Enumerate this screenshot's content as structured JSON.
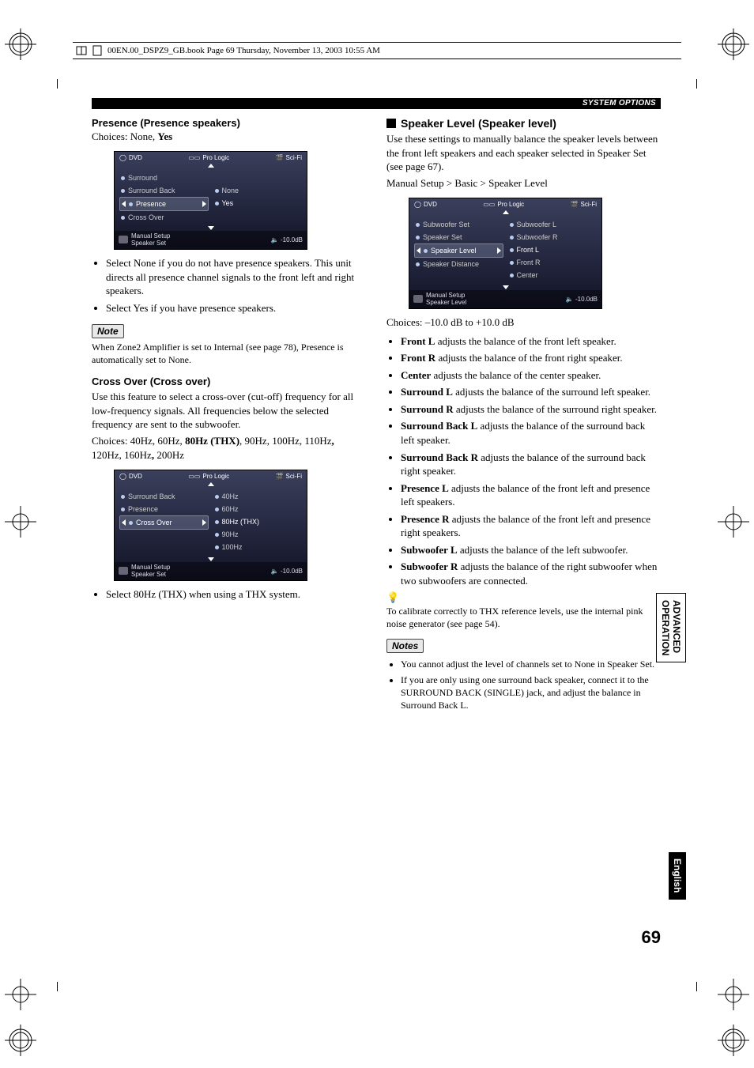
{
  "meta": {
    "book_line": "00EN.00_DSPZ9_GB.book  Page 69  Thursday, November 13, 2003  10:55 AM"
  },
  "header_bar": "SYSTEM OPTIONS",
  "side_tab1_a": "ADVANCED",
  "side_tab1_b": "OPERATION",
  "side_tab2": "English",
  "page_number": "69",
  "left": {
    "presence_title": "Presence (Presence speakers)",
    "presence_choices_a": "Choices: None, ",
    "presence_choices_b": "Yes",
    "osd1": {
      "head_l": "DVD",
      "head_c": "Pro Logic",
      "head_r": "Sci-Fi",
      "items": [
        "Surround",
        "Surround Back",
        "Presence",
        "Cross Over"
      ],
      "opts": [
        "None",
        "Yes"
      ],
      "selected_item": "Presence",
      "foot_l1": "Manual Setup",
      "foot_l2": "Speaker Set",
      "foot_r": "-10.0dB"
    },
    "presence_bullets": [
      "Select None if you do not have presence speakers. This unit directs all presence channel signals to the front left and right speakers.",
      "Select Yes if you have presence speakers."
    ],
    "note_label": "Note",
    "note_body": "When Zone2 Amplifier is set to Internal (see page 78), Presence is automatically set to None.",
    "crossover_title": "Cross Over (Cross over)",
    "crossover_body": "Use this feature to select a cross-over (cut-off) frequency for all low-frequency signals. All frequencies below the selected frequency are sent to the subwoofer.",
    "crossover_choices_a": "Choices: 40Hz, 60Hz, ",
    "crossover_choices_b": "80Hz (THX)",
    "crossover_choices_c": ", 90Hz, 100Hz, 110Hz",
    "crossover_choices_d": ", ",
    "crossover_choices_e": "120Hz, 160Hz",
    "crossover_choices_f": ", ",
    "crossover_choices_g": "200Hz",
    "osd2": {
      "head_l": "DVD",
      "head_c": "Pro Logic",
      "head_r": "Sci-Fi",
      "items": [
        "Surround Back",
        "Presence",
        "Cross Over"
      ],
      "opts": [
        "40Hz",
        "60Hz",
        "80Hz (THX)",
        "90Hz",
        "100Hz"
      ],
      "selected_item": "Cross Over",
      "foot_l1": "Manual Setup",
      "foot_l2": "Speaker Set",
      "foot_r": "-10.0dB"
    },
    "crossover_bullets": [
      "Select 80Hz (THX) when using a THX system."
    ]
  },
  "right": {
    "speaker_title": "Speaker Level (Speaker level)",
    "speaker_intro": "Use these settings to manually balance the speaker levels between the front left speakers and each speaker selected in Speaker Set (see page 67).",
    "speaker_path": "Manual Setup > Basic > Speaker Level",
    "osd3": {
      "head_l": "DVD",
      "head_c": "Pro Logic",
      "head_r": "Sci-Fi",
      "items": [
        "Subwoofer Set",
        "Speaker Set",
        "Speaker Level",
        "Speaker Distance"
      ],
      "opts": [
        "Subwoofer L",
        "Subwoofer R",
        "Front L",
        "Front R",
        "Center"
      ],
      "selected_item": "Speaker Level",
      "foot_l1": "Manual Setup",
      "foot_l2": "Speaker Level",
      "foot_r": "-10.0dB"
    },
    "choices_line": "Choices: –10.0 dB to +10.0 dB",
    "bullets": [
      {
        "b": "Front L",
        "t": " adjusts the balance of the front left speaker."
      },
      {
        "b": "Front R",
        "t": " adjusts the balance of the front right speaker."
      },
      {
        "b": "Center",
        "t": " adjusts the balance of the center speaker."
      },
      {
        "b": "Surround L",
        "t": " adjusts the balance of the surround left speaker."
      },
      {
        "b": "Surround R",
        "t": " adjusts the balance of the surround right speaker."
      },
      {
        "b": "Surround Back L",
        "t": " adjusts the balance of the surround back left speaker."
      },
      {
        "b": "Surround Back R",
        "t": " adjusts the balance of the surround back right speaker."
      },
      {
        "b": "Presence L",
        "t": " adjusts the balance of the front left and presence left speakers."
      },
      {
        "b": "Presence R",
        "t": " adjusts the balance of the front left and presence right speakers."
      },
      {
        "b": "Subwoofer L",
        "t": " adjusts the balance of the left subwoofer."
      },
      {
        "b": "Subwoofer R",
        "t": " adjusts the balance of the right subwoofer when two subwoofers are connected."
      }
    ],
    "tip_body": "To calibrate correctly to THX reference levels, use the internal pink noise generator (see page 54).",
    "notes_label": "Notes",
    "notes": [
      "You cannot adjust the level of channels set to None in Speaker Set.",
      "If you are only using one surround back speaker, connect it to the SURROUND BACK (SINGLE) jack, and adjust the balance in Surround Back L."
    ]
  }
}
